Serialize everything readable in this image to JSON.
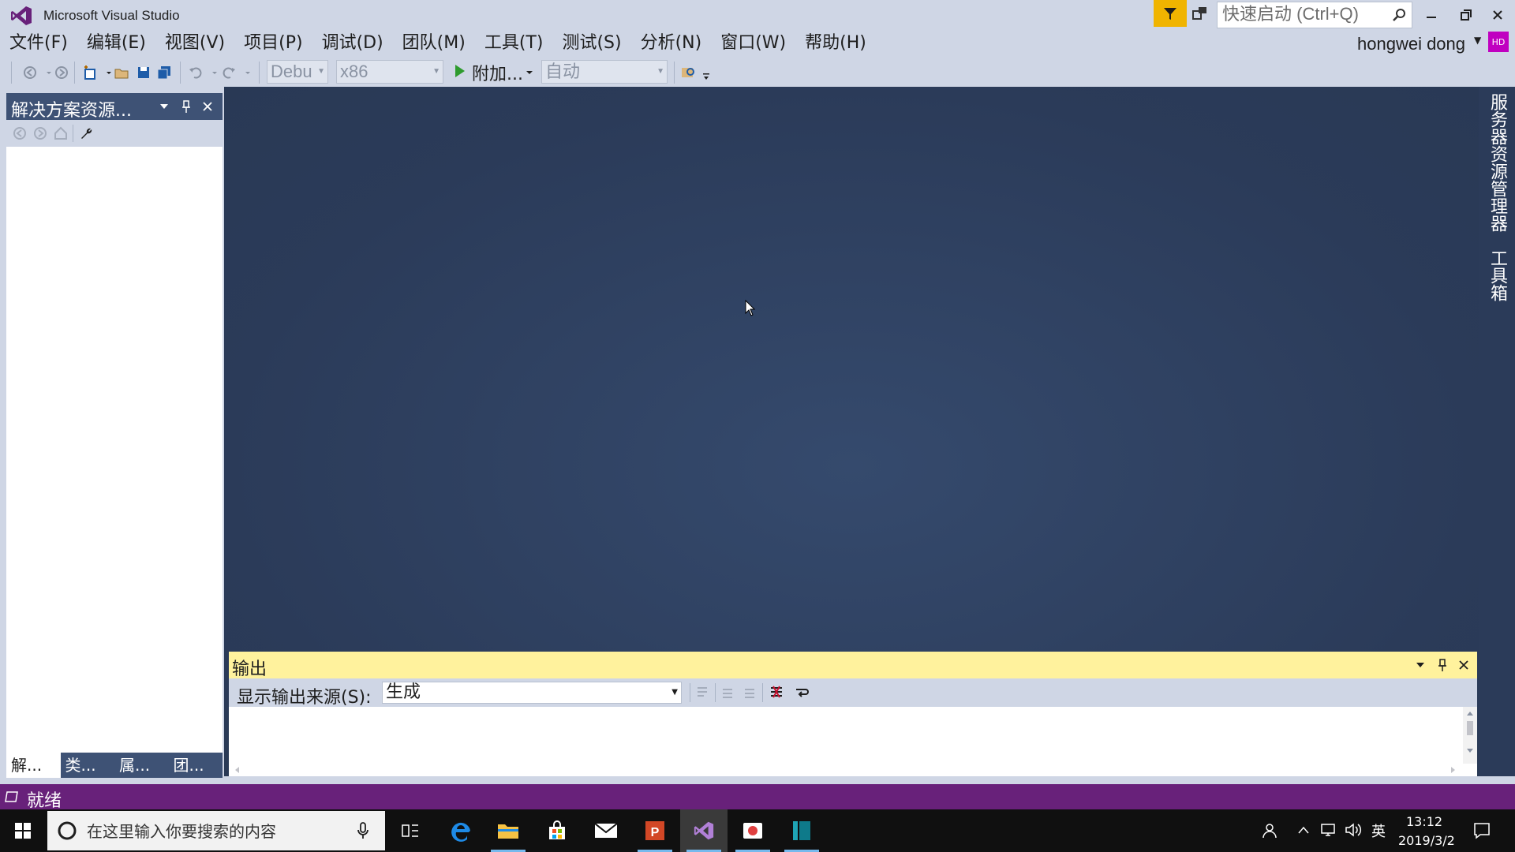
{
  "window": {
    "title": "Microsoft Visual Studio",
    "quick_launch_placeholder": "快速启动 (Ctrl+Q)"
  },
  "menu": [
    "文件(F)",
    "编辑(E)",
    "视图(V)",
    "项目(P)",
    "调试(D)",
    "团队(M)",
    "工具(T)",
    "测试(S)",
    "分析(N)",
    "窗口(W)",
    "帮助(H)"
  ],
  "user": {
    "name": "hongwei dong",
    "initials": "HD"
  },
  "toolbar": {
    "config": "Debu",
    "platform": "x86",
    "run_label": "附加...",
    "target": "自动"
  },
  "solution_explorer": {
    "title": "解决方案资源...",
    "tabs": [
      "解...",
      "类...",
      "属...",
      "团..."
    ]
  },
  "right_tabs": [
    "服务器资源管理器",
    "工具箱"
  ],
  "output": {
    "title": "输出",
    "source_label": "显示输出来源(S):",
    "source_value": "生成"
  },
  "status": {
    "text": "就绪"
  },
  "taskbar": {
    "search_placeholder": "在这里输入你要搜索的内容",
    "ime": "英",
    "time": "13:12",
    "date": "2019/3/2"
  },
  "colors": {
    "chrome": "#cfd6e5",
    "editor_bg": "#2b3b59",
    "status_bar": "#68217a",
    "output_header": "#fff29d",
    "tool_header": "#3e5275"
  }
}
